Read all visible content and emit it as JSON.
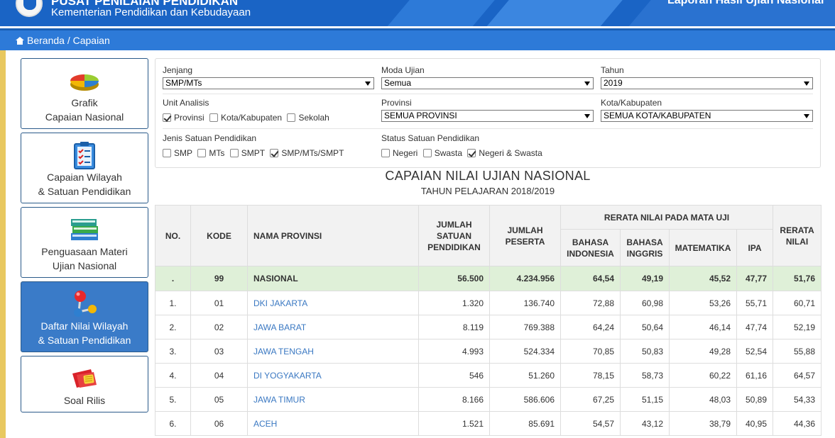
{
  "header": {
    "title": "PUSAT PENILAIAN PENDIDIKAN",
    "subtitle": "Kementerian Pendidikan dan Kebudayaan",
    "right_title": "Laporan Hasil Ujian Nasional"
  },
  "breadcrumb": "Beranda / Capaian",
  "sidebar": {
    "items": [
      {
        "line1": "Grafik",
        "line2": "Capaian Nasional",
        "icon": "pie-chart-icon"
      },
      {
        "line1": "Capaian Wilayah",
        "line2": "& Satuan Pendidikan",
        "icon": "checklist-icon"
      },
      {
        "line1": "Penguasaan Materi",
        "line2": "Ujian Nasional",
        "icon": "books-icon"
      },
      {
        "line1": "Daftar Nilai Wilayah",
        "line2": "& Satuan Pendidikan",
        "icon": "network-icon"
      },
      {
        "line1": "Soal Rilis",
        "line2": "",
        "icon": "ticket-icon"
      }
    ],
    "active_index": 3
  },
  "filters": {
    "jenjang": {
      "label": "Jenjang",
      "value": "SMP/MTs"
    },
    "moda": {
      "label": "Moda Ujian",
      "value": "Semua"
    },
    "tahun": {
      "label": "Tahun",
      "value": "2019"
    },
    "unit": {
      "label": "Unit Analisis",
      "options": [
        {
          "text": "Provinsi",
          "checked": true
        },
        {
          "text": "Kota/Kabupaten",
          "checked": false
        },
        {
          "text": "Sekolah",
          "checked": false
        }
      ]
    },
    "provinsi": {
      "label": "Provinsi",
      "value": "SEMUA PROVINSI"
    },
    "kota": {
      "label": "Kota/Kabupaten",
      "value": "SEMUA KOTA/KABUPATEN"
    },
    "jenis": {
      "label": "Jenis Satuan Pendidikan",
      "options": [
        {
          "text": "SMP",
          "checked": false
        },
        {
          "text": "MTs",
          "checked": false
        },
        {
          "text": "SMPT",
          "checked": false
        },
        {
          "text": "SMP/MTs/SMPT",
          "checked": true
        }
      ]
    },
    "status": {
      "label": "Status Satuan Pendidikan",
      "options": [
        {
          "text": "Negeri",
          "checked": false
        },
        {
          "text": "Swasta",
          "checked": false
        },
        {
          "text": "Negeri & Swasta",
          "checked": true
        }
      ]
    }
  },
  "report": {
    "title": "CAPAIAN NILAI UJIAN NASIONAL",
    "subtitle": "TAHUN PELAJARAN 2018/2019"
  },
  "table": {
    "headers": {
      "no": "NO.",
      "kode": "KODE",
      "nama": "NAMA PROVINSI",
      "jumlah_satuan": "JUMLAH SATUAN PENDIDIKAN",
      "jumlah_peserta": "JUMLAH PESERTA",
      "rerata_group": "RERATA NILAI PADA MATA UJI",
      "bindo": "BAHASA INDONESIA",
      "bing": "BAHASA INGGRIS",
      "mat": "MATEMATIKA",
      "ipa": "IPA",
      "rerata": "RERATA NILAI"
    },
    "rows": [
      {
        "no": ".",
        "kode": "99",
        "nama": "NASIONAL",
        "satuan": "56.500",
        "peserta": "4.234.956",
        "bindo": "64,54",
        "bing": "49,19",
        "mat": "45,52",
        "ipa": "47,77",
        "rerata": "51,76",
        "national": true
      },
      {
        "no": "1.",
        "kode": "01",
        "nama": "DKI JAKARTA",
        "satuan": "1.320",
        "peserta": "136.740",
        "bindo": "72,88",
        "bing": "60,98",
        "mat": "53,26",
        "ipa": "55,71",
        "rerata": "60,71"
      },
      {
        "no": "2.",
        "kode": "02",
        "nama": "JAWA BARAT",
        "satuan": "8.119",
        "peserta": "769.388",
        "bindo": "64,24",
        "bing": "50,64",
        "mat": "46,14",
        "ipa": "47,74",
        "rerata": "52,19"
      },
      {
        "no": "3.",
        "kode": "03",
        "nama": "JAWA TENGAH",
        "satuan": "4.993",
        "peserta": "524.334",
        "bindo": "70,85",
        "bing": "50,83",
        "mat": "49,28",
        "ipa": "52,54",
        "rerata": "55,88"
      },
      {
        "no": "4.",
        "kode": "04",
        "nama": "DI YOGYAKARTA",
        "satuan": "546",
        "peserta": "51.260",
        "bindo": "78,15",
        "bing": "58,73",
        "mat": "60,22",
        "ipa": "61,16",
        "rerata": "64,57"
      },
      {
        "no": "5.",
        "kode": "05",
        "nama": "JAWA TIMUR",
        "satuan": "8.166",
        "peserta": "586.606",
        "bindo": "67,25",
        "bing": "51,15",
        "mat": "48,03",
        "ipa": "50,89",
        "rerata": "54,33"
      },
      {
        "no": "6.",
        "kode": "06",
        "nama": "ACEH",
        "satuan": "1.521",
        "peserta": "85.691",
        "bindo": "54,57",
        "bing": "43,12",
        "mat": "38,79",
        "ipa": "40,95",
        "rerata": "44,36"
      }
    ]
  }
}
